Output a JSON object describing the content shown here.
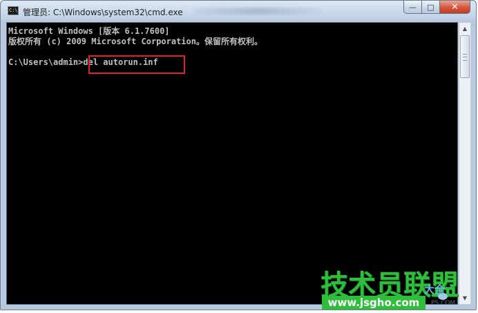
{
  "window": {
    "title": "管理员: C:\\Windows\\system32\\cmd.exe",
    "icon_text": "C:\\",
    "controls": {
      "minimize": "—",
      "maximize": "□",
      "close": "✕"
    }
  },
  "console": {
    "lines": [
      "Microsoft Windows [版本 6.1.7600]",
      "版权所有 (c) 2009 Microsoft Corporation。保留所有权利。",
      "",
      "C:\\Users\\admin>del autorun.inf"
    ]
  },
  "watermark": {
    "title": "技术员联盟",
    "subtitle": "大全",
    "url": "www.jsgho.com",
    "small": "PS.COM"
  }
}
